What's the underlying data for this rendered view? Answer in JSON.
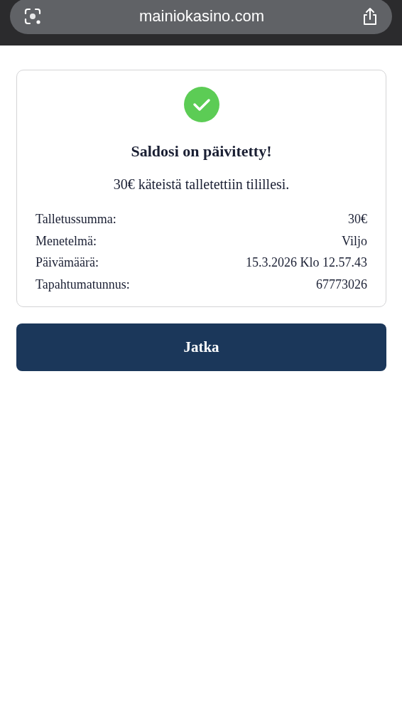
{
  "browser": {
    "url": "mainiokasino.com"
  },
  "confirmation": {
    "title": "Saldosi on päivitetty!",
    "message": "30€ käteistä talletettiin tilillesi.",
    "details": [
      {
        "label": "Talletussumma:",
        "value": "30€"
      },
      {
        "label": "Menetelmä:",
        "value": "Viljo"
      },
      {
        "label": "Päivämäärä:",
        "value": "15.3.2026 Klo 12.57.43"
      },
      {
        "label": "Tapahtumatunnus:",
        "value": "67773026"
      }
    ]
  },
  "continue_button": "Jatka"
}
